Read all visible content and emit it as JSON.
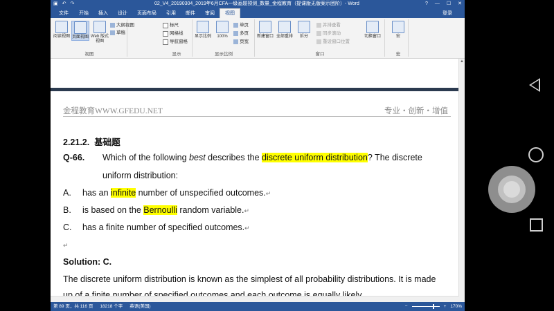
{
  "window": {
    "title": "02_V4_20190304_2019年6月CFA一级画题预测_数量_金程教育（提课版无版案示团阶）- Word",
    "controls": [
      "?",
      "—",
      "☐",
      "✕"
    ]
  },
  "tabs": [
    {
      "label": "文件"
    },
    {
      "label": "开始"
    },
    {
      "label": "插入"
    },
    {
      "label": "设计"
    },
    {
      "label": "页面布局"
    },
    {
      "label": "引用"
    },
    {
      "label": "邮件"
    },
    {
      "label": "审阅"
    },
    {
      "label": "视图"
    }
  ],
  "login": "登录",
  "ribbon": {
    "views": {
      "group_label": "视图",
      "read_mode": "阅读视图",
      "print_layout": "页面视图",
      "web_layout": "Web 版式视图",
      "outline": "大纲视图",
      "draft": "草稿"
    },
    "show": {
      "group_label": "显示",
      "ruler": "标尺",
      "gridlines": "网格线",
      "nav_pane": "导航窗格"
    },
    "zoom": {
      "group_label": "显示比例",
      "zoom": "显示比例",
      "hundred": "100%",
      "one_page": "单页",
      "multi_page": "多页",
      "page_width": "页宽"
    },
    "window": {
      "group_label": "窗口",
      "new_window": "新建窗口",
      "arrange_all": "全部重排",
      "split": "拆分",
      "side_by_side": "并排查看",
      "sync_scroll": "同步滚动",
      "reset_pos": "重设窗口位置",
      "switch_window": "切换窗口"
    },
    "macros": {
      "group_label": "宏",
      "macros": "宏"
    }
  },
  "document": {
    "header_left": "金程教育WWW.GFEDU.NET",
    "header_right": "专业・创新・增值",
    "section_num": "2.21.2.",
    "section_title": "基础题",
    "q_num": "Q-66.",
    "q_text_1": "Which of the following ",
    "q_text_best": "best",
    "q_text_2": " describes the ",
    "q_text_hl": "discrete uniform distribution",
    "q_text_3": "? The discrete",
    "q_text_line2": "uniform distribution:",
    "options": [
      {
        "letter": "A.",
        "pre": "has an ",
        "hl": "infinite",
        "post": " number of unspecified outcomes."
      },
      {
        "letter": "B.",
        "pre": "is based on the ",
        "hl": "Bernoulli",
        "post": " random variable."
      },
      {
        "letter": "C.",
        "pre": "has a finite number of specified outcomes.",
        "hl": "",
        "post": ""
      }
    ],
    "solution_label": "Solution: C.",
    "solution_text": "The discrete uniform distribution is known as the simplest of all probability distributions. It is made",
    "solution_text_cut": "up of a finite number of specified outcomes and each outcome is equally likely."
  },
  "status": {
    "page": "第 89 页，共 116 页",
    "words": "18218 个字",
    "lang": "英语(美国)",
    "zoom": "170%"
  }
}
